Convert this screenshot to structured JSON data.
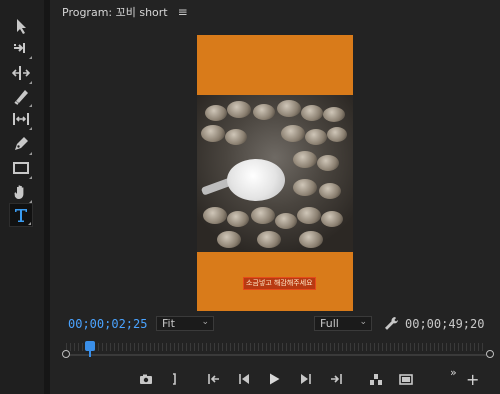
{
  "tools": [
    {
      "name": "selection-tool",
      "icon": "arrow-pointer-icon"
    },
    {
      "name": "track-select-tool",
      "icon": "track-select-icon"
    },
    {
      "name": "ripple-edit-tool",
      "icon": "ripple-edit-icon"
    },
    {
      "name": "razor-tool",
      "icon": "razor-icon"
    },
    {
      "name": "slip-tool",
      "icon": "slip-icon"
    },
    {
      "name": "pen-tool",
      "icon": "pen-icon"
    },
    {
      "name": "rectangle-tool",
      "icon": "rectangle-icon"
    },
    {
      "name": "hand-tool",
      "icon": "hand-icon"
    },
    {
      "name": "type-tool",
      "icon": "type-icon",
      "active": true
    }
  ],
  "panel": {
    "title": "Program: 꼬비 short",
    "menu_icon": "hamburger-menu-icon"
  },
  "viewer": {
    "background_color": "#d97b1a",
    "subtitle": "소금넣고 해감해주세요"
  },
  "controls": {
    "timecode_current": "00;00;02;25",
    "zoom_level": "Fit",
    "resolution": "Full",
    "timecode_duration": "00;00;49;20",
    "accent_color": "#4aa3ff"
  },
  "scrub": {
    "playhead_fraction": 0.057
  },
  "transport": [
    {
      "name": "export-frame-button",
      "icon": "camera-icon"
    },
    {
      "name": "mark-out-button",
      "icon": "bracket-icon"
    },
    {
      "name": "go-to-in-button",
      "icon": "go-to-in-icon"
    },
    {
      "name": "step-back-button",
      "icon": "step-back-icon"
    },
    {
      "name": "play-button",
      "icon": "play-icon"
    },
    {
      "name": "step-forward-button",
      "icon": "step-forward-icon"
    },
    {
      "name": "go-to-out-button",
      "icon": "go-to-out-icon"
    },
    {
      "name": "lift-button",
      "icon": "lift-icon"
    },
    {
      "name": "extract-button",
      "icon": "extract-icon"
    }
  ],
  "more_label": "»",
  "add_label": "+"
}
